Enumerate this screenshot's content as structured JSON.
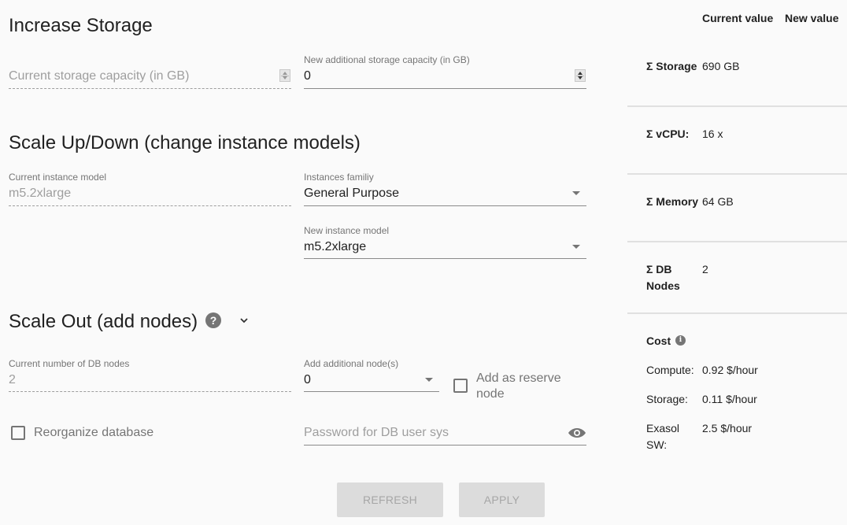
{
  "storage": {
    "title": "Increase Storage",
    "current_placeholder": "Current storage capacity (in GB)",
    "new_label": "New additional storage capacity (in GB)",
    "new_value": "0"
  },
  "scale_up": {
    "title": "Scale Up/Down (change instance models)",
    "current_label": "Current instance model",
    "current_value": "m5.2xlarge",
    "family_label": "Instances familiy",
    "family_value": "General Purpose",
    "new_model_label": "New instance model",
    "new_model_value": "m5.2xlarge"
  },
  "scale_out": {
    "title": "Scale Out (add nodes)",
    "help_icon": "help-circle-icon",
    "expand_icon": "chevron-down-icon",
    "current_label": "Current number of DB nodes",
    "current_value": "2",
    "add_label": "Add additional node(s)",
    "add_value": "0",
    "reserve_label": "Add as reserve node",
    "reserve_checked": false
  },
  "reorganize": {
    "label": "Reorganize database",
    "checked": false
  },
  "password": {
    "placeholder": "Password for DB user sys",
    "visibility_icon": "eye-icon"
  },
  "buttons": {
    "refresh": "REFRESH",
    "apply": "APPLY"
  },
  "summary": {
    "headers": {
      "current": "Current value",
      "new": "New value"
    },
    "rows": [
      {
        "label": "Σ Storage",
        "current": "690 GB",
        "new": ""
      },
      {
        "label": "Σ vCPU:",
        "current": "16 x",
        "new": ""
      },
      {
        "label": "Σ Memory",
        "current": "64 GB",
        "new": ""
      },
      {
        "label": "Σ DB Nodes",
        "current": "2",
        "new": ""
      }
    ],
    "cost": {
      "title": "Cost",
      "info_icon": "info-icon",
      "items": [
        {
          "label": "Compute:",
          "value": "0.92 $/hour"
        },
        {
          "label": "Storage:",
          "value": "0.11 $/hour"
        },
        {
          "label": "Exasol SW:",
          "value": "2.5 $/hour"
        }
      ]
    }
  }
}
